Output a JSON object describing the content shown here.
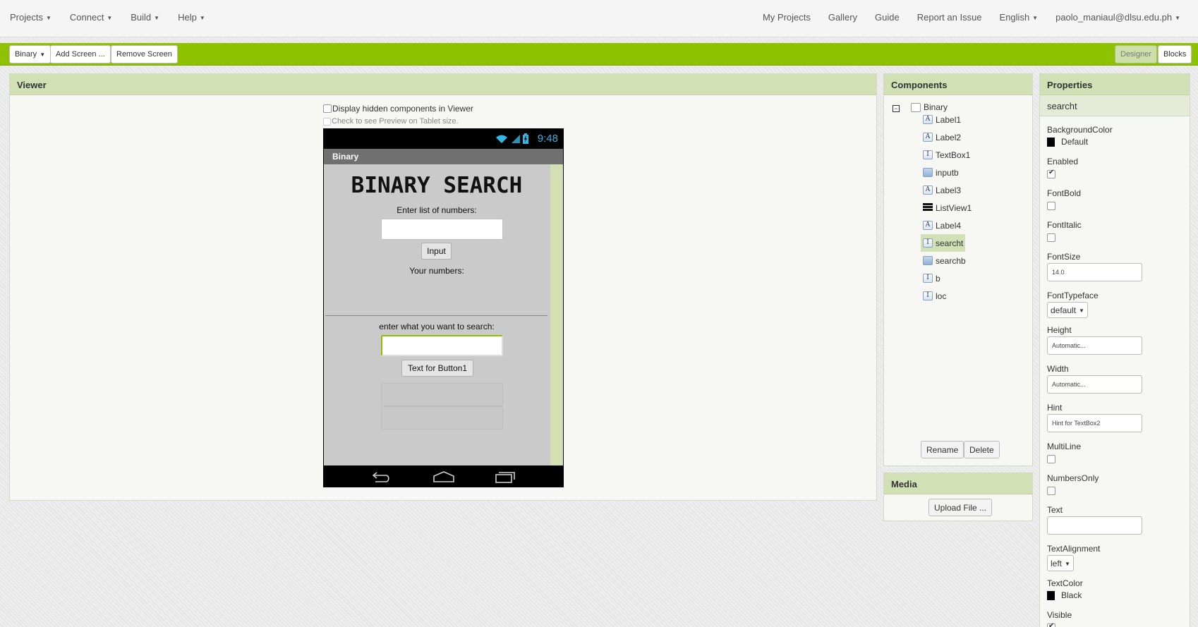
{
  "topnav": {
    "left": [
      "Projects",
      "Connect",
      "Build",
      "Help"
    ],
    "my_projects": "My Projects",
    "gallery": "Gallery",
    "guide": "Guide",
    "report": "Report an Issue",
    "language": "English",
    "user": "paolo_maniaul@dlsu.edu.ph"
  },
  "toolbar": {
    "screen_select": "Binary",
    "add_screen": "Add Screen ...",
    "remove_screen": "Remove Screen",
    "designer": "Designer",
    "blocks": "Blocks"
  },
  "viewer": {
    "title": "Viewer",
    "display_hidden": "Display hidden components in Viewer",
    "tablet_preview": "Check to see Preview on Tablet size."
  },
  "phone": {
    "time": "9:48",
    "screen_title": "Binary",
    "app_title": "BINARY SEARCH",
    "label_enter_list": "Enter list of numbers:",
    "input_button": "Input",
    "label_your_numbers": "Your numbers:",
    "label_search": "enter what you want to search:",
    "search_button": "Text for Button1"
  },
  "components": {
    "title": "Components",
    "root": "Binary",
    "items": [
      {
        "name": "Label1",
        "icon": "label-icon"
      },
      {
        "name": "Label2",
        "icon": "label-icon"
      },
      {
        "name": "TextBox1",
        "icon": "textbox-icon"
      },
      {
        "name": "inputb",
        "icon": "button-icon"
      },
      {
        "name": "Label3",
        "icon": "label-icon"
      },
      {
        "name": "ListView1",
        "icon": "listview-icon"
      },
      {
        "name": "Label4",
        "icon": "label-icon"
      },
      {
        "name": "searcht",
        "icon": "textbox-icon"
      },
      {
        "name": "searchb",
        "icon": "button-icon"
      },
      {
        "name": "b",
        "icon": "textbox-icon"
      },
      {
        "name": "loc",
        "icon": "textbox-icon"
      }
    ],
    "selected": "searcht",
    "rename": "Rename",
    "delete": "Delete"
  },
  "media": {
    "title": "Media",
    "upload": "Upload File ..."
  },
  "properties": {
    "title": "Properties",
    "selected": "searcht",
    "background_color_label": "BackgroundColor",
    "background_color_value": "Default",
    "enabled_label": "Enabled",
    "enabled": true,
    "fontbold_label": "FontBold",
    "fontbold": false,
    "fontitalic_label": "FontItalic",
    "fontitalic": false,
    "fontsize_label": "FontSize",
    "fontsize_value": "14.0",
    "fonttypeface_label": "FontTypeface",
    "fonttypeface_value": "default",
    "height_label": "Height",
    "height_value": "Automatic...",
    "width_label": "Width",
    "width_value": "Automatic...",
    "hint_label": "Hint",
    "hint_value": "Hint for TextBox2",
    "multiline_label": "MultiLine",
    "multiline": false,
    "numbersonly_label": "NumbersOnly",
    "numbersonly": false,
    "text_label": "Text",
    "text_value": "",
    "textalignment_label": "TextAlignment",
    "textalignment_value": "left",
    "textcolor_label": "TextColor",
    "textcolor_value": "Black",
    "visible_label": "Visible",
    "visible": true
  },
  "colors": {
    "accent_green": "#8dc200",
    "panel_header": "#d2e0b6",
    "clock_blue": "#33b5e5"
  }
}
